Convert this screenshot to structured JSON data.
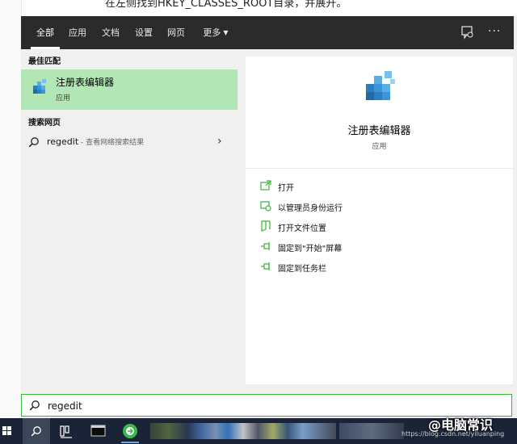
{
  "background": {
    "article_line": "在左侧找到HKEY_CLASSES_ROOT目录，并展开。"
  },
  "tabs": [
    {
      "label": "全部",
      "active": true
    },
    {
      "label": "应用"
    },
    {
      "label": "文档"
    },
    {
      "label": "设置"
    },
    {
      "label": "网页"
    },
    {
      "label": "更多"
    }
  ],
  "header_icons": {
    "feedback": "feedback-icon",
    "more": "···"
  },
  "left": {
    "best_match_label": "最佳匹配",
    "best_match": {
      "title": "注册表编辑器",
      "subtitle": "应用",
      "icon": "regedit-cubes-icon"
    },
    "web_label": "搜索网页",
    "web_result": {
      "query": "regedit",
      "hint": " - 查看网络搜索结果"
    }
  },
  "detail": {
    "title": "注册表编辑器",
    "subtitle": "应用",
    "actions": [
      {
        "label": "打开",
        "icon": "open-icon"
      },
      {
        "label": "以管理员身份运行",
        "icon": "shield-icon"
      },
      {
        "label": "打开文件位置",
        "icon": "folder-icon"
      },
      {
        "label": "固定到\"开始\"屏幕",
        "icon": "pin-icon"
      },
      {
        "label": "固定到任务栏",
        "icon": "pin-icon"
      }
    ]
  },
  "search": {
    "value": "regedit"
  },
  "watermark": {
    "title": "@电脑常识",
    "url": "https://blog.csdn.net/yiluanping"
  },
  "colors": {
    "accent": "#37b535",
    "highlight": "#b3e6b5",
    "header": "#2b2b2b",
    "taskbar": "#1b2436"
  }
}
